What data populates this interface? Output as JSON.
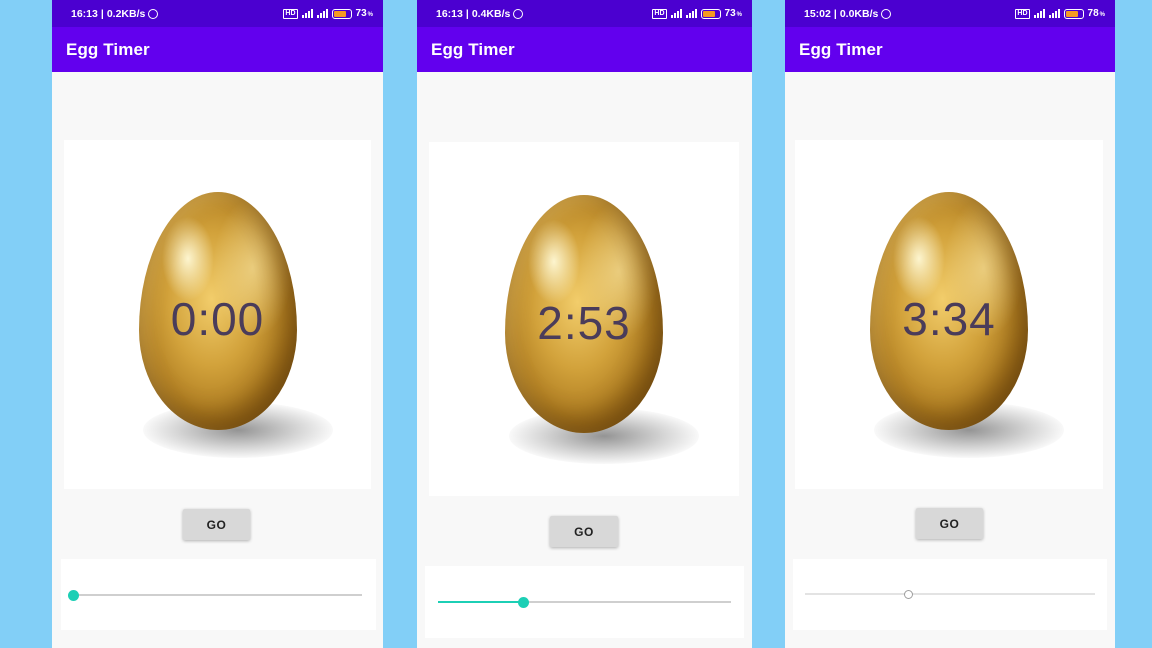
{
  "screens": [
    {
      "status": {
        "time": "16:13",
        "speed": "0.2KB/s",
        "battery": "73",
        "battery_unit": "%"
      },
      "app_title": "Egg Timer",
      "timer": "0:00",
      "go_label": "GO",
      "slider": {
        "value_fraction": 0.0,
        "enabled": true
      }
    },
    {
      "status": {
        "time": "16:13",
        "speed": "0.4KB/s",
        "battery": "73",
        "battery_unit": "%"
      },
      "app_title": "Egg Timer",
      "timer": "2:53",
      "go_label": "GO",
      "slider": {
        "value_fraction": 0.29,
        "enabled": true
      }
    },
    {
      "status": {
        "time": "15:02",
        "speed": "0.0KB/s",
        "battery": "78",
        "battery_unit": "%"
      },
      "app_title": "Egg Timer",
      "timer": "3:34",
      "go_label": "GO",
      "slider": {
        "value_fraction": 0.36,
        "enabled": false
      }
    }
  ],
  "colors": {
    "background": "#82cff7",
    "status_bar": "#4b00d0",
    "app_bar": "#6200ee",
    "slider_accent": "#1ccfb5",
    "timer_text": "#4a3c5a"
  },
  "icons": [
    "alarm-icon",
    "sim-icon",
    "signal-icon",
    "battery-icon",
    "egg-image"
  ]
}
